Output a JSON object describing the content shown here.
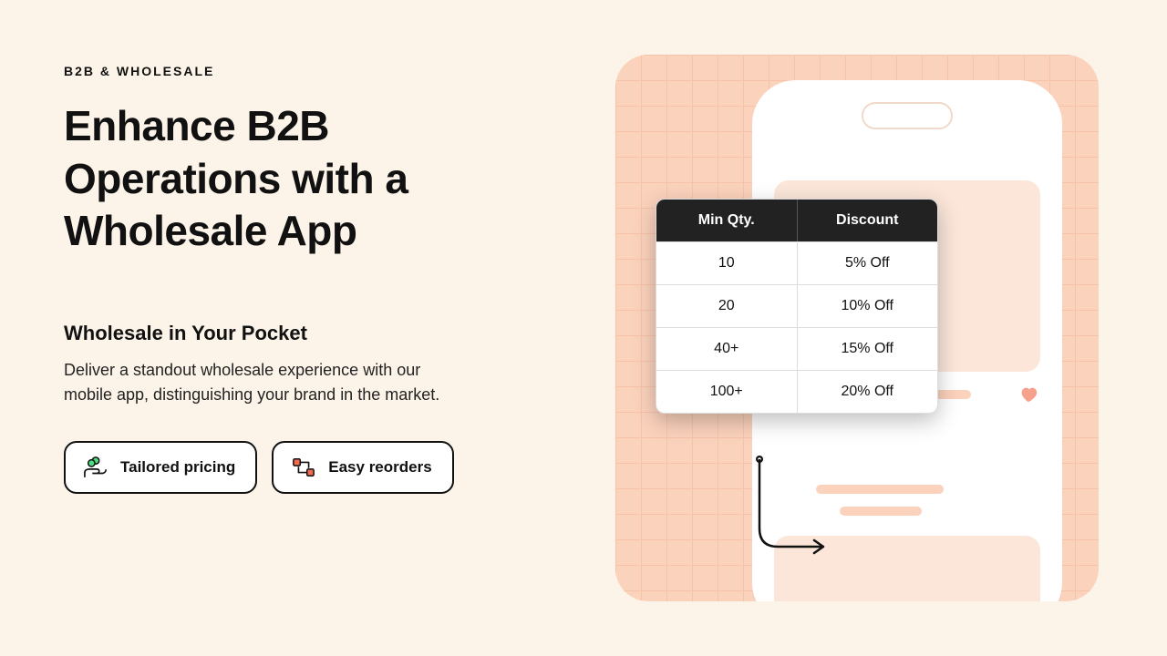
{
  "eyebrow": "B2B & WHOLESALE",
  "headline": "Enhance B2B Operations with a Wholesale App",
  "subtitle": "Wholesale in Your Pocket",
  "body": "Deliver a standout wholesale experience with our mobile app, distinguishing your brand in the market.",
  "pills": {
    "tailored": "Tailored pricing",
    "reorders": "Easy reorders"
  },
  "table": {
    "header_qty": "Min Qty.",
    "header_discount": "Discount",
    "rows": [
      {
        "qty": "10",
        "discount": "5% Off"
      },
      {
        "qty": "20",
        "discount": "10% Off"
      },
      {
        "qty": "40+",
        "discount": "15% Off"
      },
      {
        "qty": "100+",
        "discount": "20% Off"
      }
    ]
  }
}
